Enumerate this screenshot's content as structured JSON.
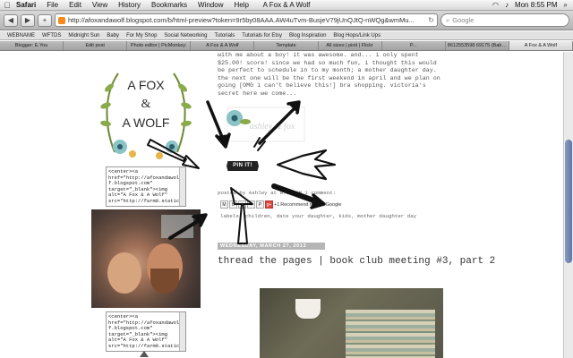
{
  "menubar": {
    "app": "Safari",
    "items": [
      "File",
      "Edit",
      "View",
      "History",
      "Bookmarks",
      "Window",
      "Help"
    ],
    "window_title": "A Fox & A Wolf",
    "clock": "Mon 8:55 PM"
  },
  "toolbar": {
    "url": "http://afoxandawolf.blogspot.com/b/html-preview?token=9r5by08AAA.AW4uTvm-BusjeV79jUnQJtQ-nWQg&wmMu...",
    "search_placeholder": "Google"
  },
  "bookmarks": [
    "WEBNAME",
    "WFTDS",
    "Midnight Sun",
    "Baby",
    "For My Shop",
    "Social Networking",
    "Tutorials",
    "Tutorials for Etsy",
    "Blog Inspiration",
    "Blog Hops/Link Ups"
  ],
  "tabs": [
    "Blogger: E.You",
    "Edit post",
    "Photo editor | PicMonkey:",
    "A Fox & A Wolf",
    "Template",
    "All sizes | pinit | Flickr",
    "P...",
    "8612553598 69175 (Babe...",
    "A Fox & A Wolf"
  ],
  "sidebar": {
    "logo_lines": [
      "A FOX",
      "&",
      "A WOLF"
    ],
    "embed_code_1": "<center><a\nhref=\"http://afoxandawol\nf.blogspot.com\"\ntarget=\"_blank\"><img\nalt=\"A Fox & A Wolf\"\nsrc=\"http://farm9.staticfl",
    "embed_code_2": "<center><a\nhref=\"http://afoxandawol\nf.blogspot.com\"\ntarget=\"_blank\"><img\nalt=\"A Fox & A Wolf\"\nsrc=\"http://farm9.staticfl"
  },
  "post": {
    "body": "with me about a boy! it was awesome. and... i only spent $25.00! score! since we had so much fun, i thought this would be perfect to schedule in to my month; a mother daughter day. the next one will be the first weekend in april and we plan on going [OMG i can't believe this!] bra shopping. victoria's secret here we come...",
    "signature": "ashley & fox",
    "meta": "posted by Ashley at 8:00 AM   1 comment:",
    "share_count": "+1",
    "share_text": "Recommend this on Google",
    "labels": "labels: children, date your daughter, kids, mother daughter day",
    "date": "WEDNESDAY, MARCH 27, 2013",
    "title": "thread the pages | book club meeting #3, part 2"
  },
  "pinit_label": "PIN IT!",
  "colors": {
    "accent": "#5f77a8",
    "date_band": "#b5b5b5",
    "pin_ink": "#222222"
  }
}
